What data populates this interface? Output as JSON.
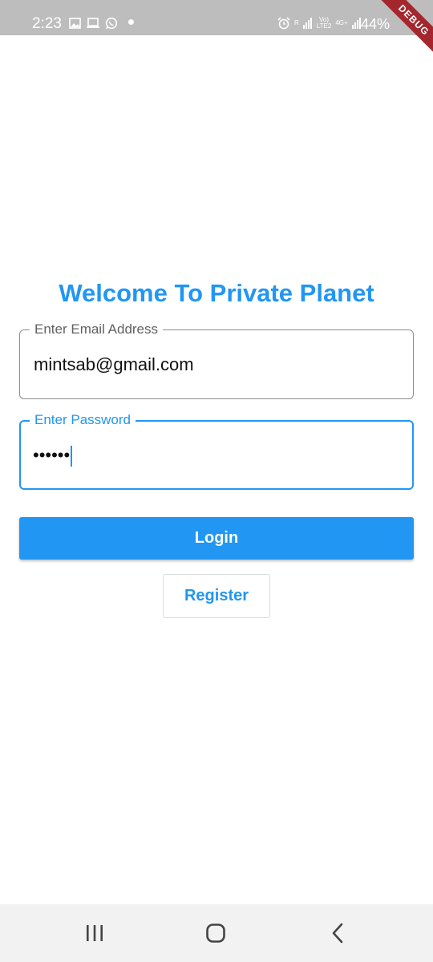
{
  "status_bar": {
    "time": "2:23",
    "battery": "44%",
    "network_volte": "Vo)",
    "network_lte": "LTE2",
    "network_4g": "4G+",
    "sim_indicator": "R",
    "left_icons": [
      "image-icon",
      "laptop-icon",
      "whatsapp-icon"
    ],
    "right_icons": [
      "alarm-icon",
      "signal-icon",
      "signal-icon",
      "battery-icon"
    ],
    "debug_ribbon": "DEBUG"
  },
  "login": {
    "title": "Welcome To Private Planet",
    "email_label": "Enter Email Address",
    "email_value": "mintsab@gmail.com",
    "password_label": "Enter Password",
    "password_value": "••••••",
    "login_button": "Login",
    "register_button": "Register"
  },
  "nav_bar": {
    "buttons": [
      "recents-icon",
      "home-icon",
      "back-icon"
    ]
  },
  "colors": {
    "accent": "#2196f3",
    "status_bar": "#bdbdbd",
    "debug_ribbon": "#a3272d"
  }
}
